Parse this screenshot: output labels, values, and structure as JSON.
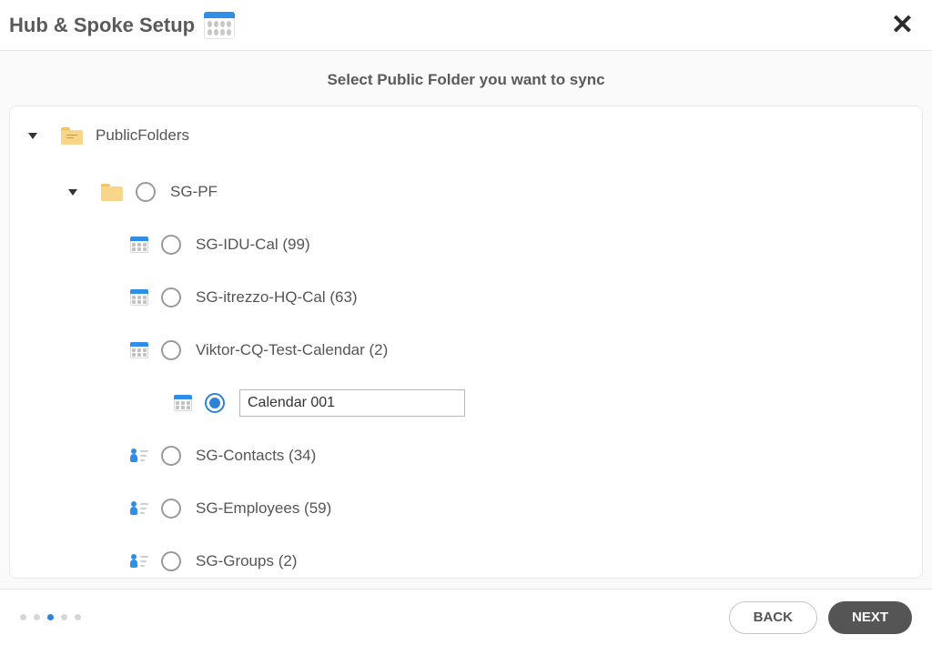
{
  "header": {
    "title": "Hub & Spoke Setup"
  },
  "subheader": "Select Public Folder you want to sync",
  "tree": {
    "root_label": "PublicFolders",
    "sg_pf_label": "SG-PF",
    "sg_idu_cal": "SG-IDU-Cal (99)",
    "sg_itrezzo_hq": "SG-itrezzo-HQ-Cal (63)",
    "viktor_cq": "Viktor-CQ-Test-Calendar (2)",
    "calendar_input_value": "Calendar 001",
    "sg_contacts": "SG-Contacts (34)",
    "sg_employees": "SG-Employees (59)",
    "sg_groups": "SG-Groups (2)"
  },
  "footer": {
    "back_label": "BACK",
    "next_label": "NEXT",
    "step_count": 5,
    "active_step_index": 2
  }
}
